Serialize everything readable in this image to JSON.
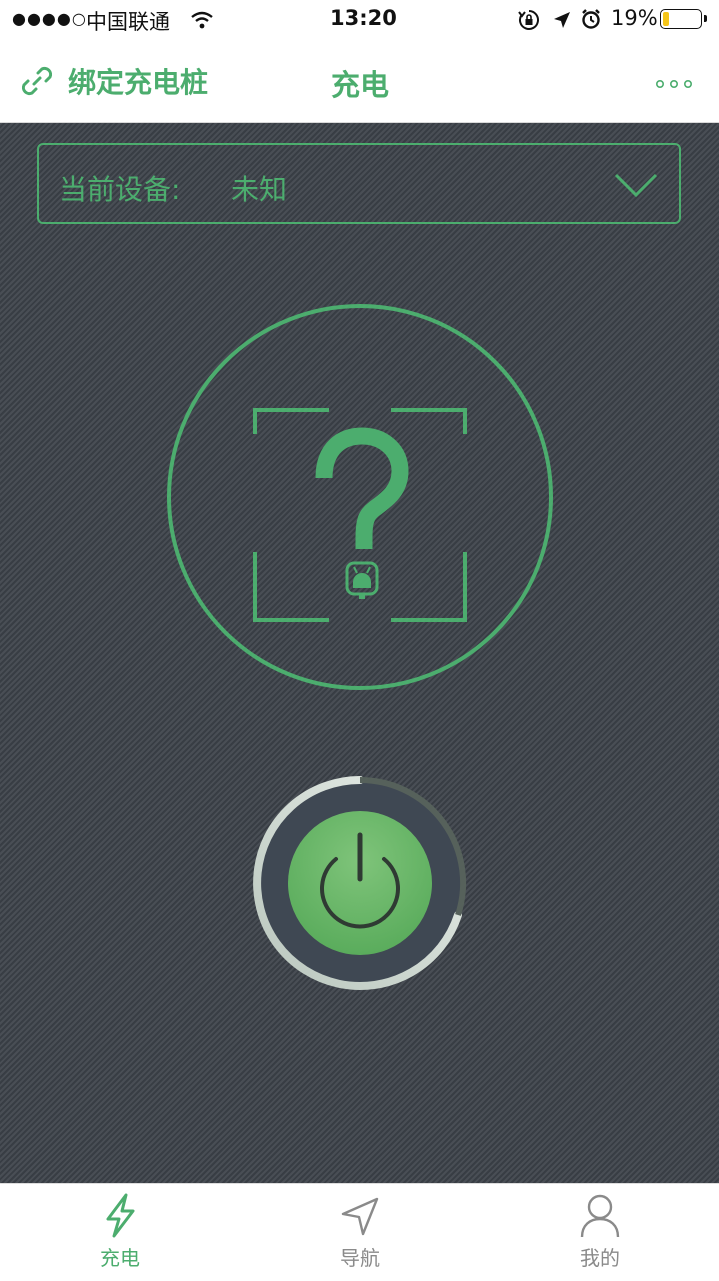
{
  "status_bar": {
    "signal": "●●●●○",
    "carrier": "中国联通",
    "time": "13:20",
    "battery_percent": "19%",
    "battery_level": 0.19
  },
  "nav": {
    "bind_label": "绑定充电桩",
    "title": "充电"
  },
  "device": {
    "label": "当前设备:",
    "value": "未知"
  },
  "tabs": [
    {
      "label": "充电",
      "icon": "lightning-icon",
      "active": true
    },
    {
      "label": "导航",
      "icon": "navigation-arrow-icon",
      "active": false
    },
    {
      "label": "我的",
      "icon": "user-icon",
      "active": false
    }
  ],
  "colors": {
    "accent": "#4cad6e",
    "background": "#3b4148",
    "tab_inactive": "#8a8a8a"
  }
}
